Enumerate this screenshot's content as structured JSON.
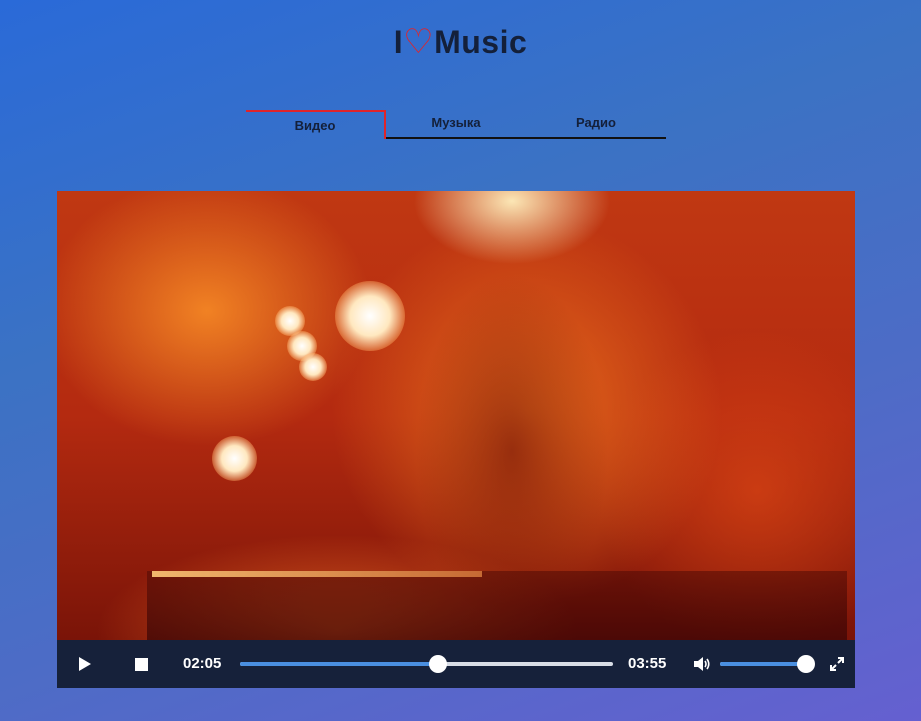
{
  "header": {
    "logo_prefix": "I",
    "logo_heart": "♡",
    "logo_suffix": "Music"
  },
  "tabs": [
    {
      "label": "Видео",
      "active": true
    },
    {
      "label": "Музыка",
      "active": false
    },
    {
      "label": "Радио",
      "active": false
    }
  ],
  "player": {
    "current_time": "02:05",
    "duration": "03:55",
    "progress_fraction": 0.532,
    "volume_fraction": 1.0,
    "icons": {
      "play": "play-icon",
      "stop": "stop-icon",
      "volume": "volume-icon",
      "fullscreen": "fullscreen-icon"
    }
  },
  "colors": {
    "accent": "#e0242a",
    "text_dark": "#14203a",
    "controls_bg": "#16213a",
    "progress_fill": "#4a8fe0"
  }
}
